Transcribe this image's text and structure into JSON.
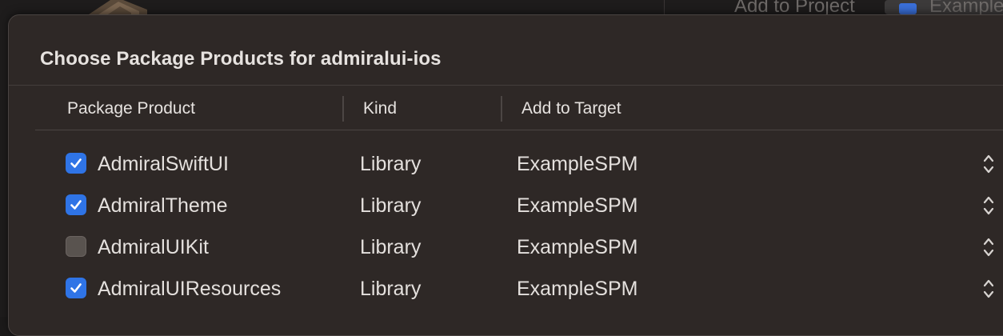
{
  "background": {
    "add_to_project_label": "Add to Project",
    "target_label": "Example"
  },
  "dialog": {
    "title": "Choose Package Products for admiralui-ios",
    "columns": {
      "product": "Package Product",
      "kind": "Kind",
      "target": "Add to Target"
    },
    "rows": [
      {
        "checked": true,
        "product": "AdmiralSwiftUI",
        "kind": "Library",
        "target": "ExampleSPM"
      },
      {
        "checked": true,
        "product": "AdmiralTheme",
        "kind": "Library",
        "target": "ExampleSPM"
      },
      {
        "checked": false,
        "product": "AdmiralUIKit",
        "kind": "Library",
        "target": "ExampleSPM"
      },
      {
        "checked": true,
        "product": "AdmiralUIResources",
        "kind": "Library",
        "target": "ExampleSPM"
      }
    ]
  },
  "colors": {
    "accent": "#2f74e6",
    "sheet_background": "#2e2826",
    "text": "#e4e0dd"
  },
  "icons": {
    "checkbox_checked": "checkmark-icon",
    "target_stepper": "chevron-up-down-icon"
  }
}
